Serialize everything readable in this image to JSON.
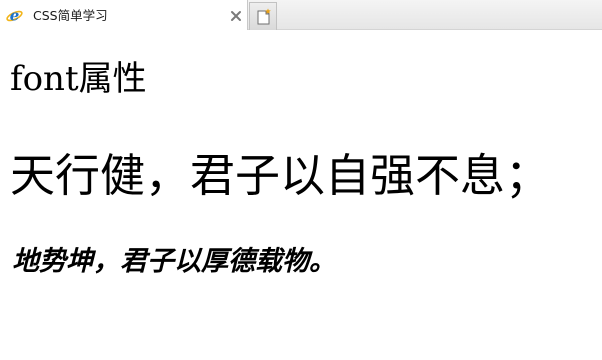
{
  "browser": {
    "tab": {
      "title": "CSS简单学习",
      "favicon": "internet-explorer-icon",
      "close_icon": "close-icon"
    },
    "new_tab_icon": "new-tab-icon"
  },
  "page": {
    "heading": "font属性",
    "line_1": "天行健，君子以自强不息；",
    "line_2": "地势坤，君子以厚德载物。"
  },
  "colors": {
    "text": "#000000",
    "ie_blue": "#1e73c8",
    "ie_ring": "#f2b51a",
    "new_tab_star": "#e8a21a"
  }
}
